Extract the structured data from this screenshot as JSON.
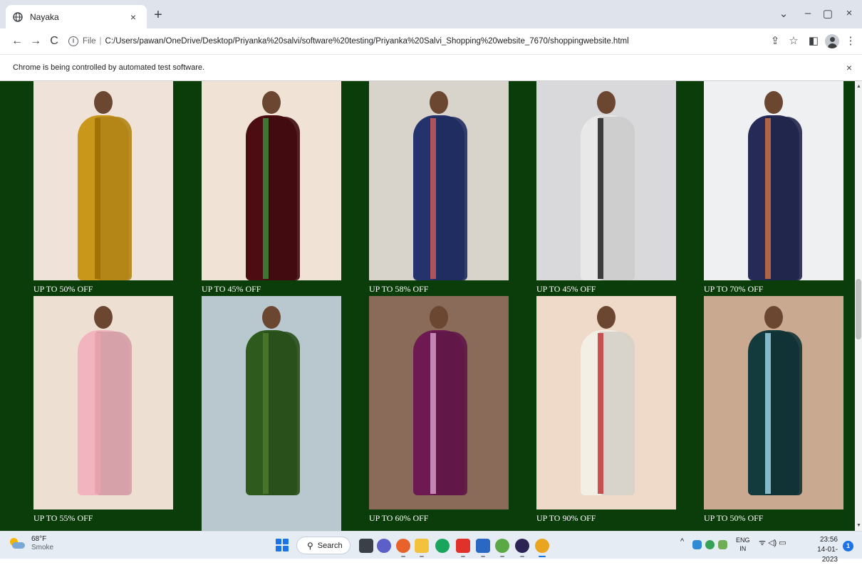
{
  "browser": {
    "tab_title": "Nayaka",
    "tab_close": "×",
    "new_tab": "+",
    "url_scheme": "File",
    "url_separator": "|",
    "url_path": "C:/Users/pawan/OneDrive/Desktop/Priyanka%20salvi/software%20testing/Priyanka%20Salvi_Shopping%20website_7670/shoppingwebsite.html",
    "infobar_text": "Chrome is being controlled by automated test software.",
    "infobar_close": "×",
    "window_controls": {
      "tab_search": "⌄",
      "minimize": "–",
      "maximize": "▢",
      "close": "×"
    },
    "nav": {
      "back": "←",
      "forward": "→",
      "reload": "C"
    },
    "toolbar_icons": {
      "share": "⇪",
      "bookmark": "☆",
      "sidepanel": "◧",
      "menu": "⋮"
    }
  },
  "products": [
    {
      "offer": "UP TO 50% OFF",
      "bg": "#efe3d9",
      "saree": "#c9971a",
      "accent": "#9c6f06"
    },
    {
      "offer": "UP TO 45% OFF",
      "bg": "#f0e3d6",
      "saree": "#4b0d12",
      "accent": "#3e8a3a"
    },
    {
      "offer": "UP TO 58% OFF",
      "bg": "#d8d4cc",
      "saree": "#24336d",
      "accent": "#c85a5a"
    },
    {
      "offer": "UP TO 45% OFF",
      "bg": "#d9d9db",
      "saree": "#e8e8e8",
      "accent": "#222222"
    },
    {
      "offer": "UP TO 70% OFF",
      "bg": "#eef0f2",
      "saree": "#252b56",
      "accent": "#c96f45"
    },
    {
      "offer": "UP TO 55% OFF",
      "bg": "#eedfd3",
      "saree": "#f2b5bf",
      "accent": "#e9a2ae"
    },
    {
      "offer": "",
      "bg": "#b9c8cf",
      "saree": "#2f5a1e",
      "accent": "#4c7a2c"
    },
    {
      "offer": "UP TO 60% OFF",
      "bg": "#8a6a58",
      "saree": "#6d1a52",
      "accent": "#d59ac8"
    },
    {
      "offer": "UP TO 90% OFF",
      "bg": "#efd9c8",
      "saree": "#f3efe4",
      "accent": "#c6373b"
    },
    {
      "offer": "UP TO 50% OFF",
      "bg": "#c9a98f",
      "saree": "#133a3d",
      "accent": "#9ad1e0"
    }
  ],
  "taskbar": {
    "weather_temp": "68°F",
    "weather_desc": "Smoke",
    "search_label": "Search",
    "lang_top": "ENG",
    "lang_bottom": "IN",
    "time": "23:56",
    "date": "14-01-2023",
    "notification_count": "1",
    "tray_chevron": "^",
    "tray_icons": "ᯤ ◁) ▭"
  }
}
